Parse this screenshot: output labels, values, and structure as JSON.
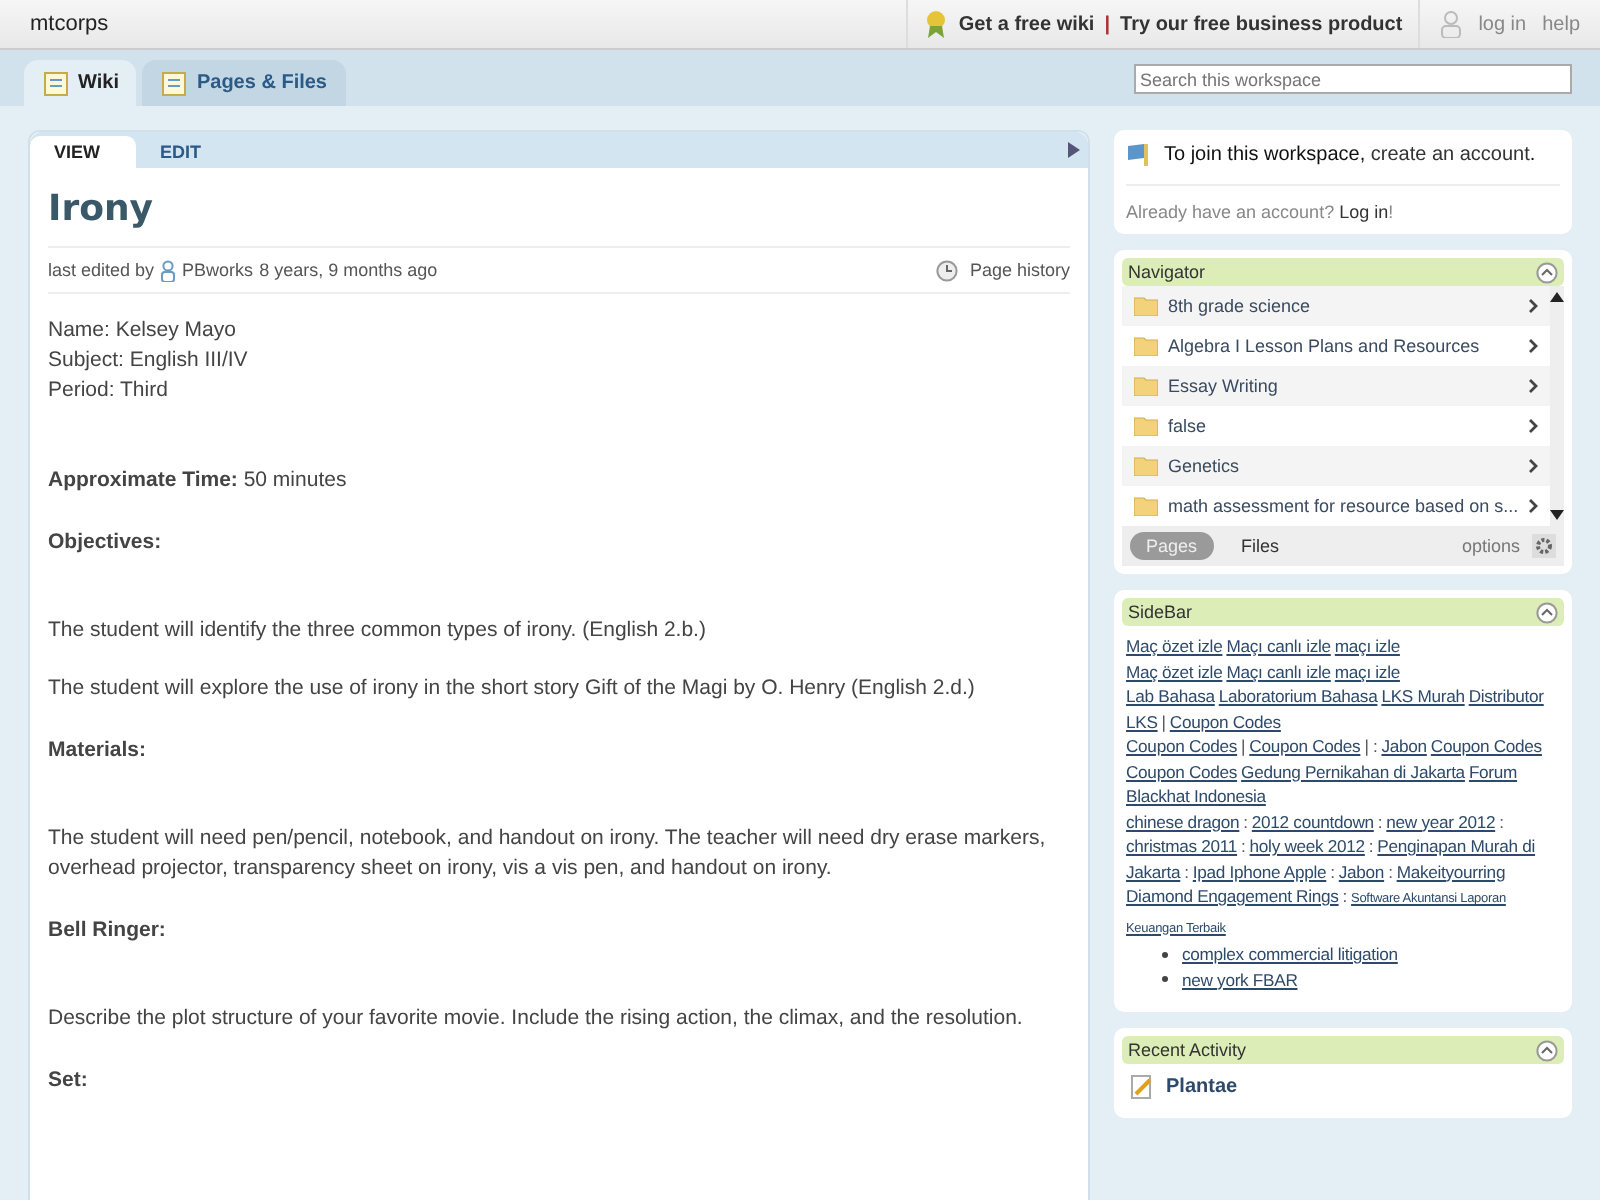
{
  "topbar": {
    "site": "mtcorps",
    "promo_links": [
      "Get a free wiki",
      "Try our free business product"
    ],
    "separator": "|",
    "account_links": [
      "log in",
      "help"
    ]
  },
  "nav_tabs": [
    {
      "label": "Wiki",
      "selected": true
    },
    {
      "label": "Pages & Files",
      "selected": false
    }
  ],
  "search": {
    "placeholder": "Search this workspace"
  },
  "page": {
    "tabs": [
      {
        "label": "VIEW",
        "selected": true
      },
      {
        "label": "EDIT",
        "selected": false
      }
    ],
    "title": "Irony",
    "meta": {
      "prefix": "last edited by",
      "author": "PBworks",
      "age": "8 years, 9 months ago"
    },
    "history_link": "Page history",
    "blocks": [
      {
        "kind": "line",
        "text": "Name: Kelsey Mayo"
      },
      {
        "kind": "line",
        "text": "Subject: English III/IV"
      },
      {
        "kind": "line",
        "text": "Period: Third"
      },
      {
        "kind": "para",
        "text": "**Approximate Time:** 50 minutes"
      },
      {
        "kind": "heading",
        "text": "Objectives:"
      },
      {
        "kind": "para",
        "text": "The student will identify the three common types of irony. (English 2.b.)"
      },
      {
        "kind": "para",
        "text": "The student will explore the use of irony in the short story Gift of the Magi by O. Henry  (English 2.d.)"
      },
      {
        "kind": "heading",
        "text": "Materials:"
      },
      {
        "kind": "para",
        "text": "The student will need pen/pencil, notebook, and handout on irony. The teacher will need dry erase markers, overhead projector, transparency sheet on irony, vis a vis pen, and handout on irony."
      },
      {
        "kind": "heading",
        "text": "Bell Ringer:"
      },
      {
        "kind": "para",
        "text": "Describe the plot structure of your favorite movie. Include the rising action, the climax, and the resolution."
      },
      {
        "kind": "heading",
        "text": "Set:"
      }
    ]
  },
  "join": {
    "text": "To join this workspace,",
    "link": "create an account",
    "end": ".",
    "login_text": "Already have an account?",
    "login_link": "Log in",
    "login_end": "!"
  },
  "navigator": {
    "title": "Navigator",
    "items": [
      "8th grade science",
      "Algebra I Lesson Plans and Resources",
      "Essay Writing",
      "false",
      "Genetics",
      "math assessment for resource based on s..."
    ],
    "tabs": [
      {
        "label": "Pages",
        "selected": true
      },
      {
        "label": "Files",
        "selected": false
      }
    ],
    "options": "options"
  },
  "sidebar": {
    "title": "SideBar",
    "lines": [
      [
        {
          "kind": "link",
          "text": "Maç özet izle"
        },
        {
          "kind": "link",
          "text": "Maçı canlı izle"
        },
        {
          "kind": "link",
          "text": "maçı izle"
        }
      ],
      [
        {
          "kind": "link",
          "text": "Maç özet izle"
        },
        {
          "kind": "link",
          "text": "Maçı canlı izle"
        },
        {
          "kind": "link",
          "text": "maçı izle"
        }
      ],
      [
        {
          "kind": "link",
          "text": "Lab Bahasa"
        },
        {
          "kind": "link",
          "text": "Laboratorium Bahasa"
        },
        {
          "kind": "link",
          "text": "LKS Murah"
        },
        {
          "kind": "link",
          "text": "Distributor"
        }
      ],
      [
        {
          "kind": "link",
          "text": "LKS"
        },
        {
          "kind": "text",
          "text": "|"
        },
        {
          "kind": "link",
          "text": "Coupon Codes"
        }
      ],
      [
        {
          "kind": "link",
          "text": "Coupon Codes"
        },
        {
          "kind": "text",
          "text": "|"
        },
        {
          "kind": "link",
          "text": "Coupon Codes"
        },
        {
          "kind": "text",
          "text": "| :"
        },
        {
          "kind": "link",
          "text": "Jabon"
        },
        {
          "kind": "link",
          "text": "Coupon Codes"
        }
      ],
      [
        {
          "kind": "link",
          "text": "Coupon Codes"
        },
        {
          "kind": "link",
          "text": "Gedung Pernikahan di Jakarta"
        },
        {
          "kind": "link",
          "text": "Forum"
        }
      ],
      [
        {
          "kind": "link",
          "text": "Blackhat Indonesia"
        }
      ],
      [
        {
          "kind": "link",
          "text": "chinese dragon"
        },
        {
          "kind": "text",
          "text": ":"
        },
        {
          "kind": "link",
          "text": "2012 countdown"
        },
        {
          "kind": "text",
          "text": ":"
        },
        {
          "kind": "link",
          "text": "new year 2012"
        },
        {
          "kind": "text",
          "text": ":"
        }
      ],
      [
        {
          "kind": "link",
          "text": "christmas 2011"
        },
        {
          "kind": "text",
          "text": ":"
        },
        {
          "kind": "link",
          "text": "holy week 2012"
        },
        {
          "kind": "text",
          "text": ":"
        },
        {
          "kind": "link",
          "text": "Penginapan Murah di"
        }
      ],
      [
        {
          "kind": "link",
          "text": "Jakarta"
        },
        {
          "kind": "text",
          "text": ":"
        },
        {
          "kind": "link",
          "text": "Ipad Iphone Apple"
        },
        {
          "kind": "text",
          "text": ":"
        },
        {
          "kind": "link",
          "text": "Jabon"
        },
        {
          "kind": "text",
          "text": ":"
        },
        {
          "kind": "link",
          "text": "Makeityourring"
        }
      ],
      [
        {
          "kind": "link",
          "text": "Diamond Engagement Rings"
        },
        {
          "kind": "text",
          "text": ":"
        },
        {
          "kind": "small_link",
          "text": "Software Akuntansi Laporan"
        }
      ],
      [
        {
          "kind": "small_link",
          "text": "Keuangan Terbaik"
        }
      ]
    ],
    "bullets": [
      "complex commercial litigation",
      "new york FBAR"
    ]
  },
  "recent_activity": {
    "title": "Recent Activity",
    "items": [
      "Plantae"
    ]
  }
}
